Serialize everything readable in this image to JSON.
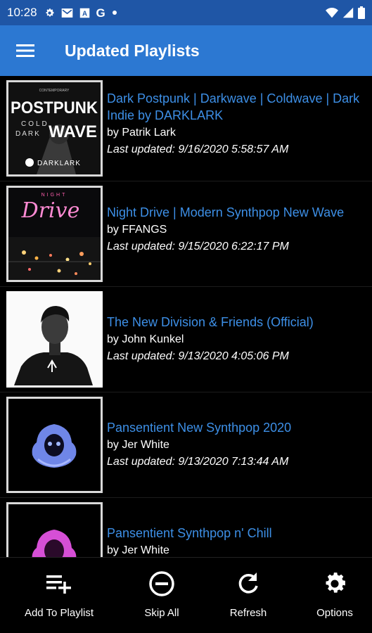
{
  "status_bar": {
    "time": "10:28",
    "left_icons": [
      "gear-icon",
      "mail-icon",
      "a-icon",
      "google-icon",
      "dot-icon"
    ],
    "right_icons": [
      "wifi-icon",
      "signal-icon",
      "battery-icon"
    ]
  },
  "app_bar": {
    "title": "Updated Playlists",
    "menu_icon": "hamburger-menu-icon"
  },
  "playlists": [
    {
      "title": "Dark Postpunk | Darkwave | Coldwave | Dark Indie by DARKLARK",
      "author": "by Patrik Lark",
      "updated": "Last updated: 9/16/2020 5:58:57 AM",
      "art": {
        "top": "POSTPUNK",
        "mid1": "COLD",
        "mid2": "DARK",
        "wave": "WAVE",
        "brand": "DARKLARK",
        "small": "CONTEMPORARY"
      }
    },
    {
      "title": "Night Drive | Modern Synthpop New Wave",
      "author": "by FFANGS",
      "updated": "Last updated: 9/15/2020 6:22:17 PM",
      "art": {
        "top": "NIGHT",
        "word": "Drive"
      }
    },
    {
      "title": "The New Division & Friends (Official)",
      "author": "by John Kunkel",
      "updated": "Last updated: 9/13/2020 4:05:06 PM"
    },
    {
      "title": "Pansentient New Synthpop 2020",
      "author": "by Jer White",
      "updated": "Last updated: 9/13/2020 7:13:44 AM"
    },
    {
      "title": "Pansentient Synthpop n' Chill",
      "author": "by Jer White",
      "updated": ""
    }
  ],
  "bottom_bar": {
    "add": {
      "label": "Add To Playlist",
      "icon": "playlist-add-icon"
    },
    "skip": {
      "label": "Skip All",
      "icon": "minus-circle-icon"
    },
    "refresh": {
      "label": "Refresh",
      "icon": "refresh-icon"
    },
    "options": {
      "label": "Options",
      "icon": "gear-icon"
    }
  },
  "colors": {
    "status_bar": "#1f56a6",
    "app_bar": "#2c78d2",
    "link": "#3d8fe6",
    "background": "#000000"
  }
}
